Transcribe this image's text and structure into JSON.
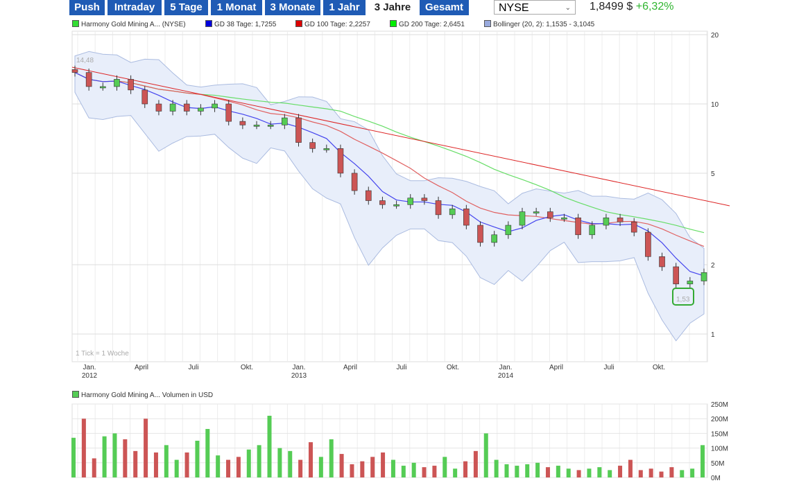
{
  "toolbar": {
    "ranges": [
      "Push",
      "Intraday",
      "5 Tage",
      "1 Monat",
      "3 Monate",
      "1 Jahr",
      "3 Jahre",
      "Gesamt"
    ],
    "active": "3 Jahre",
    "exchange": "NYSE",
    "price": "1,8499 $",
    "change": "+6,32%"
  },
  "legend": [
    {
      "label": "Harmony Gold Mining A... (NYSE)",
      "color": "#33dd33"
    },
    {
      "label": "GD 38 Tage: 1,7255",
      "color": "#0000dd"
    },
    {
      "label": "GD 100 Tage: 2,2257",
      "color": "#dd0000"
    },
    {
      "label": "GD 200 Tage: 2,6451",
      "color": "#00ee00"
    },
    {
      "label": "Bollinger (20, 2): 1,1535 - 3,1045",
      "color": "#99aadd"
    }
  ],
  "colors": {
    "up": "#55cc55",
    "down": "#cc5555",
    "gd38": "#4444ee",
    "gd100": "#e06060",
    "gd200": "#66dd66",
    "bollinger_fill": "#e8eefa",
    "bollinger_line": "#aabbe0",
    "trend": "#dd2222"
  },
  "tick_note": "1 Tick = 1 Woche",
  "high_label": "14,48",
  "low_label": "1,53",
  "volume_legend": "Harmony Gold Mining A... Volumen in USD",
  "chart_data": [
    {
      "type": "candlestick",
      "scale": "log",
      "yticks": [
        "1",
        "2",
        "5",
        "10",
        "20"
      ],
      "ylim": [
        1,
        20
      ],
      "xticks": [
        [
          "Jan.",
          "2012"
        ],
        [
          "April",
          ""
        ],
        [
          "Juli",
          ""
        ],
        [
          "Okt.",
          ""
        ],
        [
          "Jan.",
          "2013"
        ],
        [
          "April",
          ""
        ],
        [
          "Juli",
          ""
        ],
        [
          "Okt.",
          ""
        ],
        [
          "Jan.",
          "2014"
        ],
        [
          "April",
          ""
        ],
        [
          "Juli",
          ""
        ],
        [
          "Okt.",
          ""
        ]
      ],
      "closes": [
        13.7,
        11.9,
        11.9,
        12.8,
        11.5,
        10,
        9.3,
        10,
        9.3,
        9.6,
        10,
        8.4,
        8.1,
        8.1,
        8.1,
        8.7,
        6.8,
        6.4,
        6.4,
        5,
        4.2,
        3.8,
        3.65,
        3.65,
        3.9,
        3.8,
        3.3,
        3.5,
        2.97,
        2.5,
        2.7,
        2.97,
        3.4,
        3.4,
        3.2,
        3.2,
        2.7,
        2.97,
        3.2,
        3.07,
        2.77,
        2.17,
        1.96,
        1.65,
        1.7,
        1.85
      ]
    },
    {
      "type": "bar",
      "ylim": [
        0,
        250
      ],
      "yticks": [
        "0M",
        "50M",
        "100M",
        "150M",
        "200M",
        "250M"
      ],
      "unit": "M USD",
      "values": [
        135,
        200,
        65,
        140,
        150,
        130,
        90,
        200,
        85,
        110,
        60,
        85,
        125,
        165,
        75,
        60,
        70,
        95,
        110,
        210,
        100,
        90,
        60,
        120,
        70,
        130,
        80,
        45,
        55,
        70,
        85,
        60,
        40,
        50,
        35,
        40,
        70,
        30,
        55,
        90,
        150,
        60,
        45,
        40,
        45,
        50,
        35,
        40,
        30,
        25,
        30,
        35,
        25,
        40,
        60,
        25,
        30,
        20,
        35,
        25,
        30,
        110
      ]
    }
  ]
}
